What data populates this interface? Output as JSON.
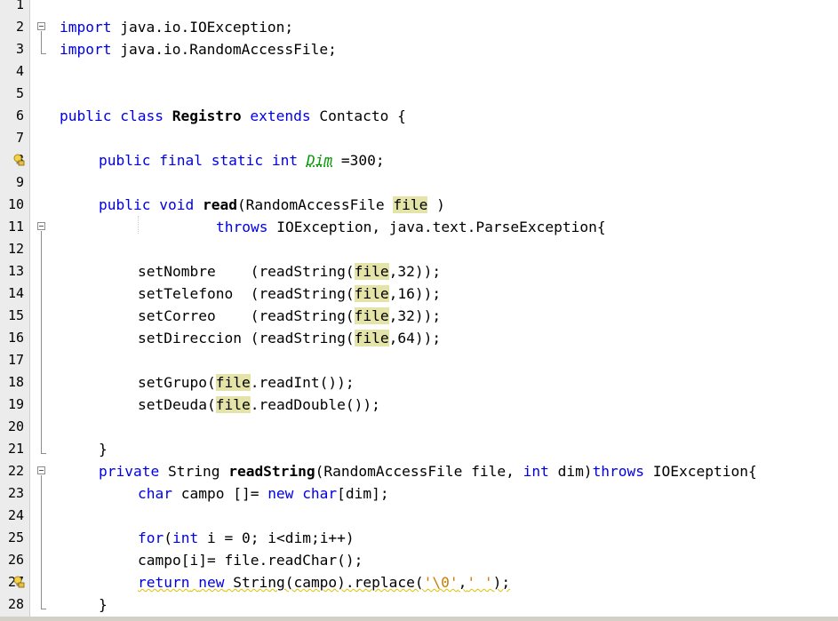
{
  "editor": {
    "line_numbers": [
      "1",
      "2",
      "3",
      "4",
      "5",
      "6",
      "7",
      "8",
      "9",
      "10",
      "11",
      "12",
      "13",
      "14",
      "15",
      "16",
      "17",
      "18",
      "19",
      "20",
      "21",
      "22",
      "23",
      "24",
      "25",
      "26",
      "27",
      "28"
    ],
    "lines": {
      "l2": {
        "kw": "import",
        "rest": " java.io.IOException;"
      },
      "l3": {
        "kw": "import",
        "rest": " java.io.RandomAccessFile;"
      },
      "l6": {
        "kw1": "public class",
        "name": "Registro",
        "kw2": "extends",
        "rest": " Contacto {"
      },
      "l8": {
        "kw": "public final static int",
        "field": "Dim",
        "rest": " =300;"
      },
      "l10": {
        "kw": "public void",
        "name": "read",
        "p1": "(RandomAccessFile ",
        "hl": "file",
        "p2": " )"
      },
      "l11": {
        "kw": "throws",
        "rest": " IOException, java.text.ParseException{"
      },
      "l13": {
        "a": "setNombre    (readString(",
        "hl": "file",
        "b": ",32));"
      },
      "l14": {
        "a": "setTelefono  (readString(",
        "hl": "file",
        "b": ",16));"
      },
      "l15": {
        "a": "setCorreo    (readString(",
        "hl": "file",
        "b": ",32));"
      },
      "l16": {
        "a": "setDireccion (readString(",
        "hl": "file",
        "b": ",64));"
      },
      "l18": {
        "a": "setGrupo(",
        "hl": "file",
        "b": ".readInt());"
      },
      "l19": {
        "a": "setDeuda(",
        "hl": "file",
        "b": ".readDouble());"
      },
      "l21": {
        "text": "}"
      },
      "l22": {
        "kw": "private",
        "t1": " String ",
        "name": "readString",
        "t2": "(RandomAccessFile file, ",
        "kw2": "int",
        "t3": " dim)",
        "kw3": "throws",
        "t4": " IOException{"
      },
      "l23": {
        "kw": "char",
        "t1": " campo []= ",
        "kw2": "new",
        "t2": " ",
        "kw3": "char",
        "t3": "[dim];"
      },
      "l25": {
        "kw": "for",
        "t1": "(",
        "kw2": "int",
        "t2": " i = 0; i<dim;i++)"
      },
      "l26": {
        "text": "campo[i]= file.readChar();"
      },
      "l27": {
        "kw": "return",
        "t1": " ",
        "kw2": "new",
        "t2": " String(campo).replace(",
        "s1": "'\\0'",
        "t3": ",",
        "s2": "' '",
        "t4": ");"
      },
      "l28": {
        "text": "}"
      }
    }
  },
  "colors": {
    "keyword": "#0000e6",
    "highlight": "#e4e4a9",
    "string": "#ce7b00",
    "field": "#009900"
  }
}
